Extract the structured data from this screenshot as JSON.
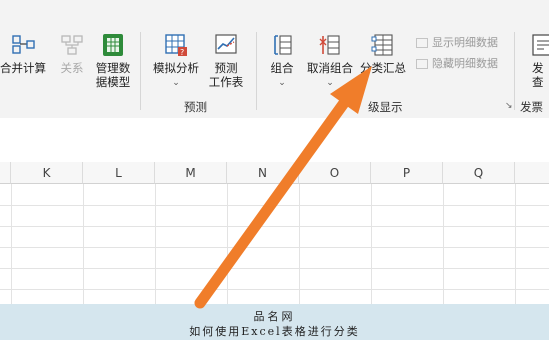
{
  "ribbon": {
    "buttons": {
      "merge_calc": "合并计算",
      "relation": "关系",
      "manage_model_line1": "管理数",
      "manage_model_line2": "据模型",
      "whatif": "模拟分析",
      "forecast_line1": "预测",
      "forecast_line2": "工作表",
      "group": "组合",
      "ungroup": "取消组合",
      "subtotal": "分类汇总",
      "show_detail": "显示明细数据",
      "hide_detail": "隐藏明细数据",
      "invoice_partial_line1": "发",
      "invoice_partial_line2": "查"
    },
    "group_labels": {
      "forecast": "预测",
      "outline_partial": "级显示",
      "invoice_partial": "发票"
    },
    "chevron": "⌄",
    "launcher": "↘"
  },
  "grid": {
    "columns": [
      "K",
      "L",
      "M",
      "N",
      "O",
      "P",
      "Q"
    ]
  },
  "caption": {
    "site": "品名网",
    "title": "如何使用Excel表格进行分类"
  },
  "colors": {
    "arrow": "#f07d2a",
    "ribbon_bg": "#f3f3f3",
    "caption_bg": "#d5e6ee",
    "icon_green": "#2e8b3a",
    "icon_blue": "#2f6fb3",
    "icon_red": "#d04a3a"
  }
}
